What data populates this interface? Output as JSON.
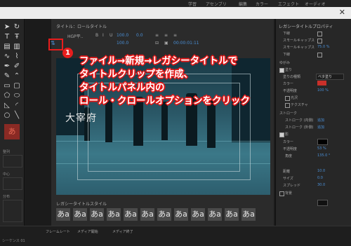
{
  "workspace_tabs": [
    "学習",
    "アセンブリ",
    "編集",
    "カラー",
    "エフェクト",
    "オーディオ"
  ],
  "editor": {
    "title": "タイトル：ロールタイトル",
    "font_value": "HGP平..",
    "size_value": "100.0",
    "tracking_value": "0.0",
    "x_value": "100.0",
    "timecode": "00:00:01:11"
  },
  "canvas_text": "大宰府",
  "styles": {
    "header": "レガシータイトルスタイル",
    "samples": [
      "あa",
      "あa",
      "あa",
      "あa",
      "あa",
      "あa",
      "あa",
      "あa",
      "あa",
      "あa",
      "あa",
      "あa"
    ]
  },
  "properties": {
    "header": "レガシータイトルプロパティ",
    "rows": [
      {
        "label": "下線",
        "value": ""
      },
      {
        "label": "スモールキャップス",
        "value": ""
      },
      {
        "label": "スモールキャップス",
        "value": "75.0 %"
      },
      {
        "label": "下線",
        "value": ""
      },
      {
        "label": "ゆがみ",
        "value": ""
      },
      {
        "label": "塗り",
        "value": ""
      },
      {
        "label": "塗りの種類",
        "value": "ベタ塗り"
      },
      {
        "label": "カラー",
        "value": ""
      },
      {
        "label": "不透明度",
        "value": "100 %"
      },
      {
        "label": "光沢",
        "value": ""
      },
      {
        "label": "テクスチャ",
        "value": ""
      },
      {
        "label": "ストローク",
        "value": ""
      },
      {
        "label": "ストローク (内側)",
        "value": "追加"
      },
      {
        "label": "ストローク (外側)",
        "value": "追加"
      },
      {
        "label": "影",
        "value": ""
      },
      {
        "label": "カラー",
        "value": ""
      },
      {
        "label": "不透明度",
        "value": "53 %"
      },
      {
        "label": "角度",
        "value": "135.0 °"
      },
      {
        "label": "距離",
        "value": "10.0"
      },
      {
        "label": "サイズ",
        "value": "0.0"
      },
      {
        "label": "スプレッド",
        "value": "30.0"
      },
      {
        "label": "背景",
        "value": ""
      }
    ]
  },
  "left": {
    "section_labels": [
      "整列",
      "中心",
      "分布"
    ]
  },
  "bottom": {
    "items": [
      "フレームレート",
      "メディア開始",
      "メディア終了"
    ],
    "sequence_label": "シーケンス 01"
  },
  "annotation": {
    "step_number": "1",
    "lines": [
      "ファイル→新規→レガシータイトルで",
      "タイトルクリップを作成、",
      "タイトルパネル内の",
      "ロール・クロールオプションをクリック"
    ]
  },
  "colors": {
    "annotation_red": "#e81d1d",
    "accent_blue": "#4a8fd6",
    "shadow_color": "#000000",
    "fill_color": "#c8302a"
  }
}
